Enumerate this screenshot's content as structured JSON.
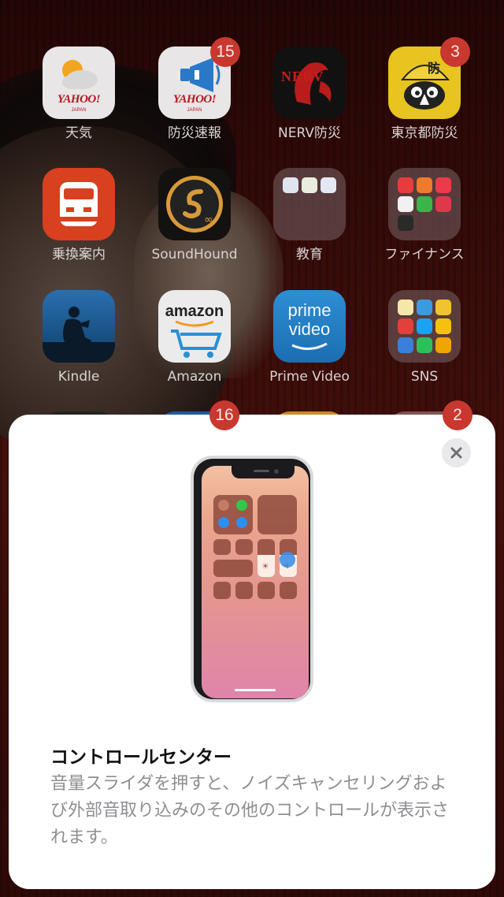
{
  "home": {
    "apps": [
      {
        "label": "天気",
        "icon": "yahoo-weather-icon"
      },
      {
        "label": "防災速報",
        "icon": "yahoo-bousai-icon",
        "badge": "15"
      },
      {
        "label": "NERV防災",
        "icon": "nerv-icon",
        "logo_text": "NERV"
      },
      {
        "label": "東京都防災",
        "icon": "tokyo-bousai-icon",
        "badge": "3",
        "logo_text": "防"
      },
      {
        "label": "乗換案内",
        "icon": "train-icon"
      },
      {
        "label": "SoundHound",
        "icon": "soundhound-icon"
      },
      {
        "label": "教育",
        "icon": "folder-icon"
      },
      {
        "label": "ファイナンス",
        "icon": "folder-icon"
      },
      {
        "label": "Kindle",
        "icon": "kindle-icon"
      },
      {
        "label": "Amazon",
        "icon": "amazon-icon",
        "logo_text": "amazon"
      },
      {
        "label": "Prime Video",
        "icon": "prime-video-icon",
        "logo_text_1": "prime",
        "logo_text_2": "video"
      },
      {
        "label": "SNS",
        "icon": "folder-icon"
      }
    ],
    "yahoo_logo": "YAHOO!",
    "yahoo_sub": "JAPAN",
    "row4_badges": [
      "16",
      "2"
    ]
  },
  "sheet": {
    "title": "コントロールセンター",
    "body": "音量スライダを押すと、ノイズキャンセリングおよび外部音取り込みのその他のコントロールが表示されます。",
    "close_icon": "close-icon",
    "illustration": "iphone-control-center-illustration"
  },
  "colors": {
    "badge": "#c8382f",
    "sheet_bg": "#ffffff",
    "accent_blue": "#2f8ff0",
    "accent_green": "#30c84a"
  }
}
